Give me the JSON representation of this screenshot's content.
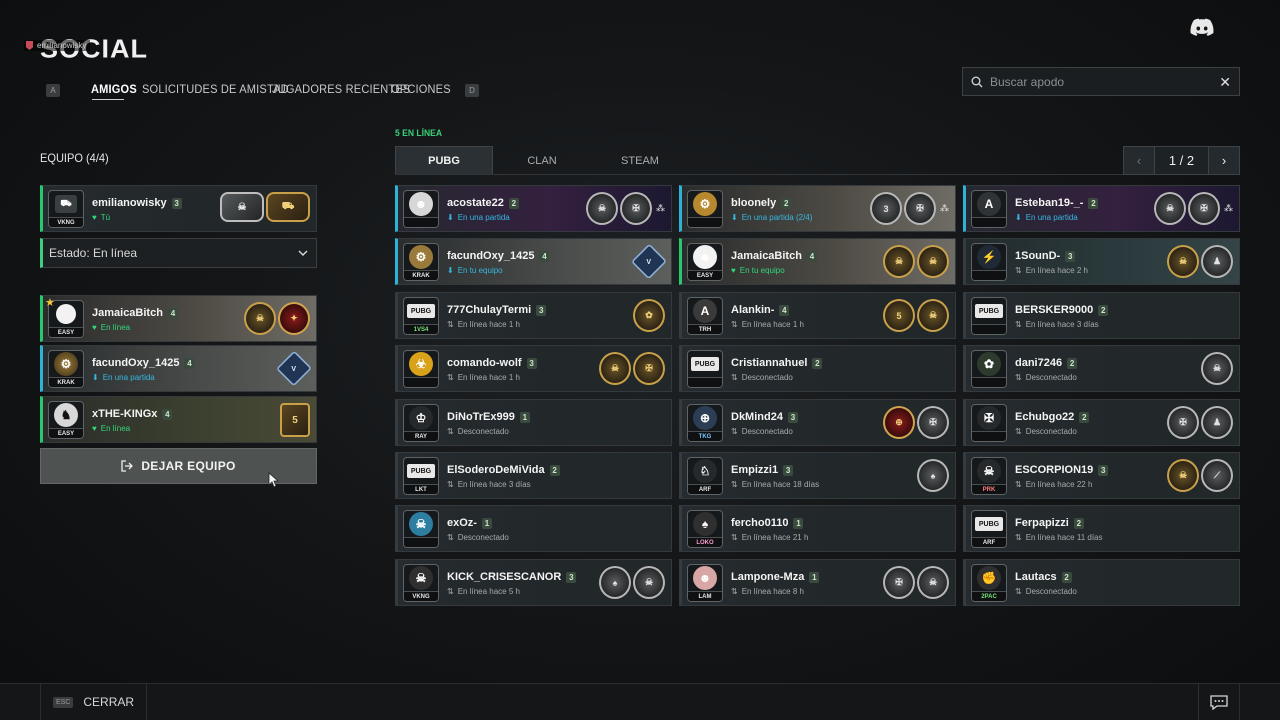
{
  "header": {
    "user_tag": "emilianowisky",
    "title": "SOCIAL",
    "key_left": "A",
    "key_right": "D",
    "tabs": [
      "AMIGOS",
      "SOLICITUDES DE AMISTAD",
      "JUGADORES RECIENTES",
      "OPCIONES"
    ]
  },
  "search": {
    "placeholder": "Buscar apodo"
  },
  "team": {
    "title": "EQUIPO (4/4)",
    "self": {
      "name": "emilianowisky",
      "level": "3",
      "status": "Tú",
      "clan": "VKNG",
      "badges": [
        "skull",
        "tank"
      ]
    },
    "status_select": "Estado: En línea",
    "members": [
      {
        "name": "JamaicaBitch",
        "level": "4",
        "status": "En línea",
        "clan": "EASY",
        "badges": [
          "skull",
          "red"
        ]
      },
      {
        "name": "facundOxy_1425",
        "level": "4",
        "status": "En una partida",
        "clan": "KRAK",
        "badges": [
          "V"
        ]
      },
      {
        "name": "xTHE-KINGx",
        "level": "4",
        "status": "En línea",
        "clan": "EASY",
        "badges": [
          "5"
        ]
      }
    ],
    "leave_button": "DEJAR EQUIPO"
  },
  "friends": {
    "online_count": "5 EN LÍNEA",
    "tabs": [
      "PUBG",
      "CLAN",
      "STEAM"
    ],
    "page": "1 / 2",
    "cards": [
      {
        "name": "acostate22",
        "level": "2",
        "status": "En una partida",
        "clan": "",
        "kind": "ingame"
      },
      {
        "name": "bloonely",
        "level": "2",
        "status": "En una partida (2/4)",
        "clan": "",
        "kind": "ingame"
      },
      {
        "name": "Esteban19-_-",
        "level": "2",
        "status": "En una partida",
        "clan": "",
        "kind": "ingame"
      },
      {
        "name": "facundOxy_1425",
        "level": "4",
        "status": "En tu equipo",
        "clan": "KRAK",
        "kind": "ingame"
      },
      {
        "name": "JamaicaBitch",
        "level": "4",
        "status": "En tu equipo",
        "clan": "EASY",
        "kind": "online"
      },
      {
        "name": "1SounD-",
        "level": "3",
        "status": "En línea hace 2 h",
        "clan": "",
        "kind": "offline"
      },
      {
        "name": "777ChulayTermi",
        "level": "3",
        "status": "En línea hace 1 h",
        "clan": "1VS4",
        "kind": "offline"
      },
      {
        "name": "Alankin-",
        "level": "4",
        "status": "En línea hace 1 h",
        "clan": "TRH",
        "kind": "offline"
      },
      {
        "name": "BERSKER9000",
        "level": "2",
        "status": "En línea hace 3 días",
        "clan": "",
        "kind": "offline"
      },
      {
        "name": "comando-wolf",
        "level": "3",
        "status": "En línea hace 1 h",
        "clan": "",
        "kind": "offline"
      },
      {
        "name": "Cristiannahuel",
        "level": "2",
        "status": "Desconectado",
        "clan": "",
        "kind": "offline"
      },
      {
        "name": "dani7246",
        "level": "2",
        "status": "Desconectado",
        "clan": "",
        "kind": "offline"
      },
      {
        "name": "DiNoTrEx999",
        "level": "1",
        "status": "Desconectado",
        "clan": "RAY",
        "kind": "offline"
      },
      {
        "name": "DkMind24",
        "level": "3",
        "status": "Desconectado",
        "clan": "TKG",
        "kind": "offline"
      },
      {
        "name": "Echubgo22",
        "level": "2",
        "status": "Desconectado",
        "clan": "",
        "kind": "offline"
      },
      {
        "name": "ElSoderoDeMiVida",
        "level": "2",
        "status": "En línea hace 3 días",
        "clan": "LKT",
        "kind": "offline"
      },
      {
        "name": "Empizzi1",
        "level": "3",
        "status": "En línea hace 18 días",
        "clan": "ARF",
        "kind": "offline"
      },
      {
        "name": "ESCORPION19",
        "level": "3",
        "status": "En línea hace 22 h",
        "clan": "PRK",
        "kind": "offline"
      },
      {
        "name": "exOz-",
        "level": "1",
        "status": "Desconectado",
        "clan": "",
        "kind": "offline"
      },
      {
        "name": "fercho0110",
        "level": "1",
        "status": "En línea hace 21 h",
        "clan": "LOKO",
        "kind": "offline"
      },
      {
        "name": "Ferpapizzi",
        "level": "2",
        "status": "En línea hace 11 días",
        "clan": "ARF",
        "kind": "offline"
      },
      {
        "name": "KICK_CRISESCANOR",
        "level": "3",
        "status": "En línea hace 5 h",
        "clan": "VKNG",
        "kind": "offline"
      },
      {
        "name": "Lampone-Mza",
        "level": "1",
        "status": "En línea hace 8 h",
        "clan": "LAM",
        "kind": "offline"
      },
      {
        "name": "Lautacs",
        "level": "2",
        "status": "Desconectado",
        "clan": "2PAC",
        "kind": "offline"
      }
    ]
  },
  "footer": {
    "esc": "ESC",
    "close": "CERRAR"
  },
  "colors": {
    "online": "#27c96e",
    "ingame": "#2db3d8",
    "accent_gold": "#c9a04a"
  }
}
